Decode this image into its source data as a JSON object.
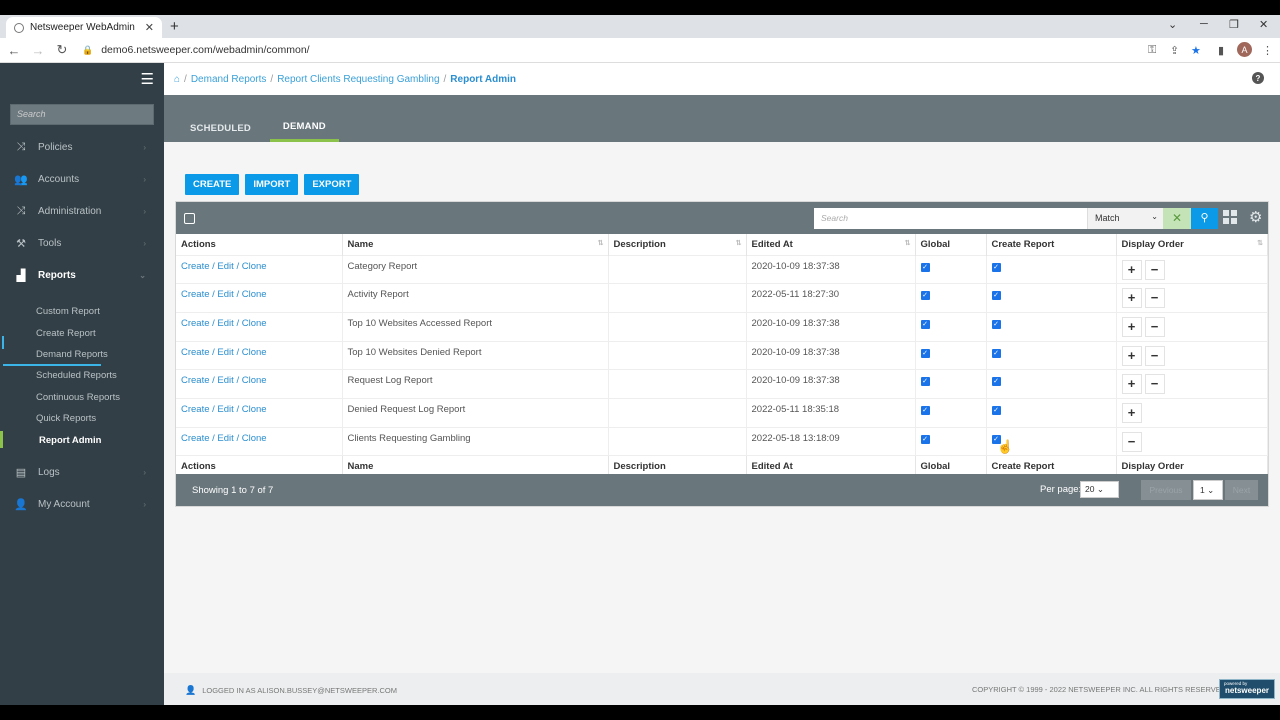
{
  "browser": {
    "tab_title": "Netsweeper WebAdmin",
    "url": "demo6.netsweeper.com/webadmin/common/",
    "avatar_letter": "A"
  },
  "sidebar": {
    "search_placeholder": "Search",
    "items": [
      {
        "label": "Policies",
        "icon": "shuffle-icon"
      },
      {
        "label": "Accounts",
        "icon": "users-icon"
      },
      {
        "label": "Administration",
        "icon": "shuffle-icon"
      },
      {
        "label": "Tools",
        "icon": "tools-icon"
      },
      {
        "label": "Reports",
        "icon": "bar-chart-icon"
      }
    ],
    "report_subitems": [
      "Custom Report",
      "Create Report",
      "Demand Reports",
      "Scheduled Reports",
      "Continuous Reports",
      "Quick Reports",
      "Report Admin"
    ],
    "bottom_items": [
      {
        "label": "Logs",
        "icon": "document-icon"
      },
      {
        "label": "My Account",
        "icon": "user-icon"
      }
    ]
  },
  "breadcrumb": {
    "items": [
      "Demand Reports",
      "Report Clients Requesting Gambling"
    ],
    "current": "Report Admin"
  },
  "tabs": [
    "SCHEDULED",
    "DEMAND"
  ],
  "buttons": {
    "create": "CREATE",
    "import": "IMPORT",
    "export": "EXPORT"
  },
  "toolbar": {
    "search_placeholder": "Search",
    "match_label": "Match"
  },
  "table": {
    "columns": [
      "Actions",
      "Name",
      "Description",
      "Edited At",
      "Global",
      "Create Report",
      "Display Order"
    ],
    "action_text": "Create / Edit / Clone",
    "rows": [
      {
        "name": "Category Report",
        "description": "",
        "edited": "2020-10-09 18:37:38",
        "global": true,
        "create_report": true,
        "order": [
          "+",
          "−"
        ]
      },
      {
        "name": "Activity Report",
        "description": "",
        "edited": "2022-05-11 18:27:30",
        "global": true,
        "create_report": true,
        "order": [
          "+",
          "−"
        ]
      },
      {
        "name": "Top 10 Websites Accessed Report",
        "description": "",
        "edited": "2020-10-09 18:37:38",
        "global": true,
        "create_report": true,
        "order": [
          "+",
          "−"
        ]
      },
      {
        "name": "Top 10 Websites Denied Report",
        "description": "",
        "edited": "2020-10-09 18:37:38",
        "global": true,
        "create_report": true,
        "order": [
          "+",
          "−"
        ]
      },
      {
        "name": "Request Log Report",
        "description": "",
        "edited": "2020-10-09 18:37:38",
        "global": true,
        "create_report": true,
        "order": [
          "+",
          "−"
        ]
      },
      {
        "name": "Denied Request Log Report",
        "description": "",
        "edited": "2022-05-11 18:35:18",
        "global": true,
        "create_report": true,
        "order": [
          "+"
        ]
      },
      {
        "name": "Clients Requesting Gambling",
        "description": "",
        "edited": "2022-05-18 13:18:09",
        "global": true,
        "create_report": true,
        "order": [
          "−"
        ]
      }
    ]
  },
  "pagination": {
    "showing": "Showing 1 to 7 of 7",
    "per_page_label": "Per page:",
    "per_page_value": "20",
    "previous": "Previous",
    "page": "1",
    "next": "Next"
  },
  "footer": {
    "logged_in": "LOGGED IN AS ALISON.BUSSEY@NETSWEEPER.COM",
    "copyright": "COPYRIGHT © 1999 - 2022 NETSWEEPER INC. ALL RIGHTS RESERVED.",
    "brand_small": "powered by",
    "brand": "netsweeper"
  },
  "colors": {
    "accent": "#0a9ae8",
    "sidebar": "#333f46",
    "toolbar": "#69767c",
    "active_marker": "#8bc34a"
  }
}
